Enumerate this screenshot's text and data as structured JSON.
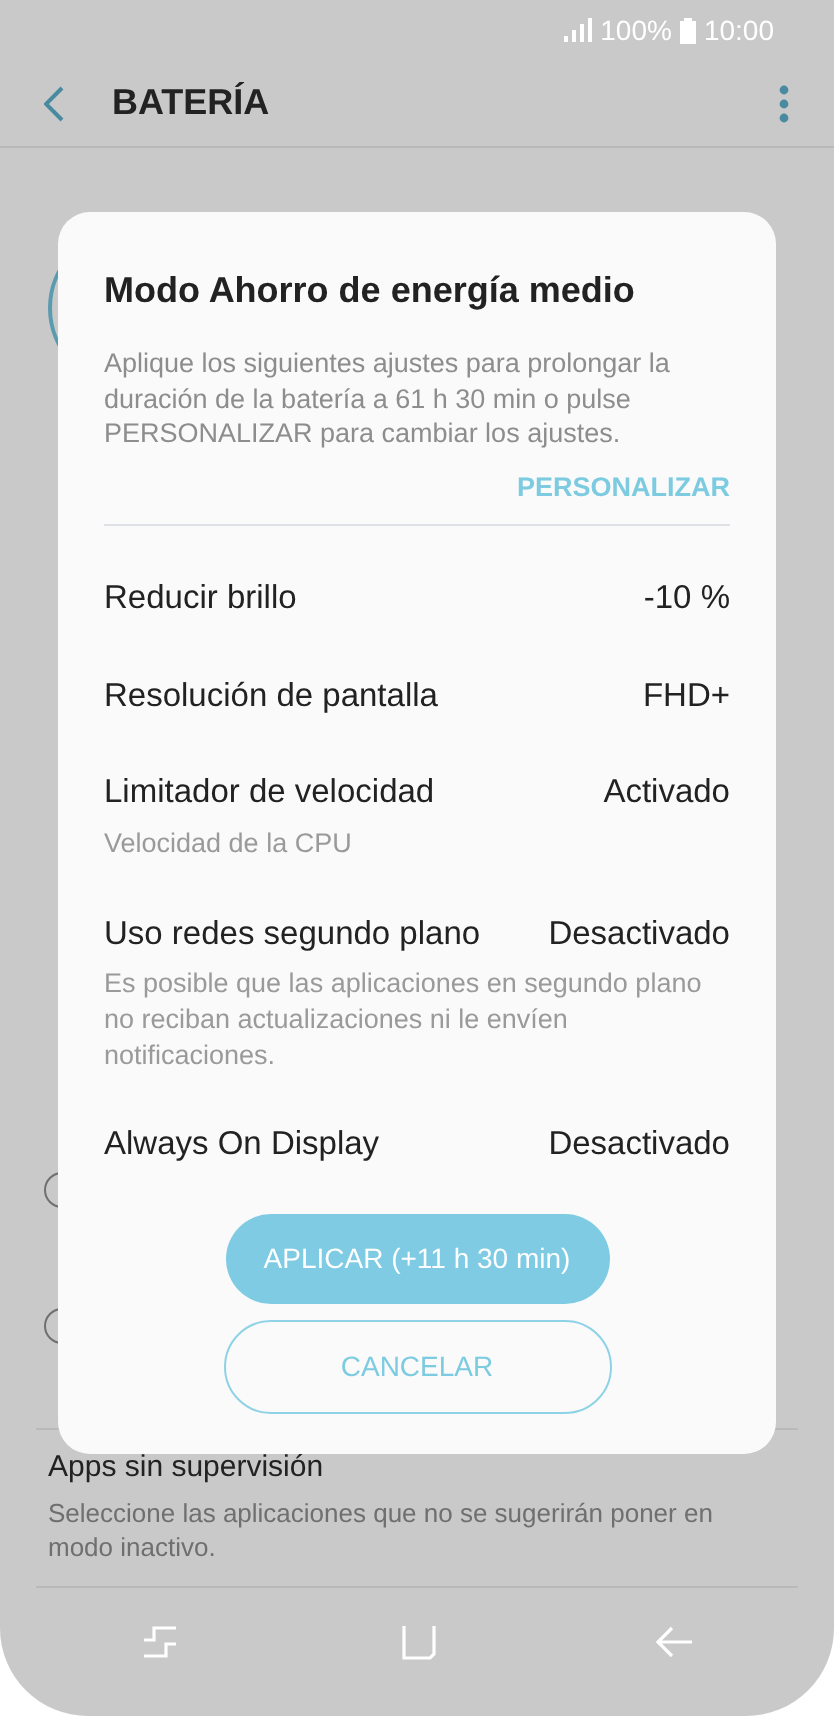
{
  "status_bar": {
    "battery": "100%",
    "time": "10:00"
  },
  "header": {
    "title": "BATERÍA"
  },
  "background_radios": [
    {
      "selected": false
    },
    {
      "selected": false
    }
  ],
  "background_items": [
    {
      "title": "Apps sin supervisión",
      "subtitle": "Seleccione las aplicaciones que no se sugerirán poner en modo inactivo."
    }
  ],
  "dialog": {
    "title": "Modo Ahorro de energía medio",
    "message": "Aplique los siguientes ajustes para prolongar la duración de la batería a 61 h 30 min o pulse PERSONALIZAR para cambiar los ajustes.",
    "link": "PERSONALIZAR",
    "settings": [
      {
        "label": "Reducir brillo",
        "value": "-10 %"
      },
      {
        "label": "Resolución de pantalla",
        "value": "FHD+"
      },
      {
        "label": "Limitador de velocidad",
        "value": "Activado",
        "note": "Velocidad de la CPU"
      },
      {
        "label": "Uso redes segundo plano",
        "value": "Desactivado",
        "note": "Es posible que las aplicaciones en segundo plano no reciban actualizaciones ni le envíen notificaciones."
      },
      {
        "label": "Always On Display",
        "value": "Desactivado"
      }
    ],
    "buttons": [
      {
        "label": "APLICAR (+11 h 30 min)",
        "kind": "primary"
      },
      {
        "label": "CANCELAR",
        "kind": "outline"
      }
    ]
  }
}
